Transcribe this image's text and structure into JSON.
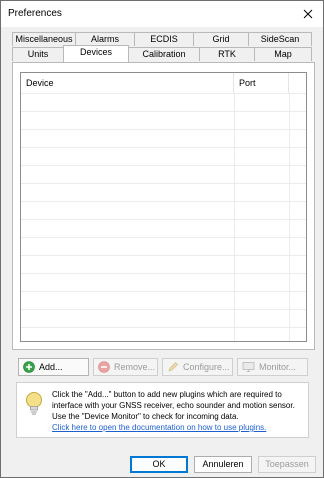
{
  "window": {
    "title": "Preferences"
  },
  "tabs": {
    "back_row": [
      "Miscellaneous",
      "Alarms",
      "ECDIS",
      "Grid",
      "SideScan"
    ],
    "front_row": [
      "Units",
      "Devices",
      "Calibration",
      "RTK",
      "Map"
    ],
    "active": "Devices"
  },
  "device_list": {
    "columns": [
      "Device",
      "Port"
    ],
    "rows": []
  },
  "actions": {
    "add": {
      "label": "Add...",
      "icon": "plus-icon",
      "enabled": true
    },
    "remove": {
      "label": "Remove...",
      "icon": "minus-icon",
      "enabled": false
    },
    "configure": {
      "label": "Configure...",
      "icon": "pencil-icon",
      "enabled": false
    },
    "monitor": {
      "label": "Monitor...",
      "icon": "monitor-icon",
      "enabled": false
    }
  },
  "info": {
    "icon": "lightbulb-icon",
    "text": "Click the \"Add...\" button to add new plugins which are required to interface with your GNSS receiver, echo sounder and motion sensor. Use the \"Device Monitor\" to check for incoming data.",
    "link": "Click here to open the documentation on how to use plugins."
  },
  "footer": {
    "ok": "OK",
    "cancel": "Annuleren",
    "apply": "Toepassen"
  },
  "colors": {
    "accent": "#0078d4",
    "link": "#1d5fcf"
  }
}
